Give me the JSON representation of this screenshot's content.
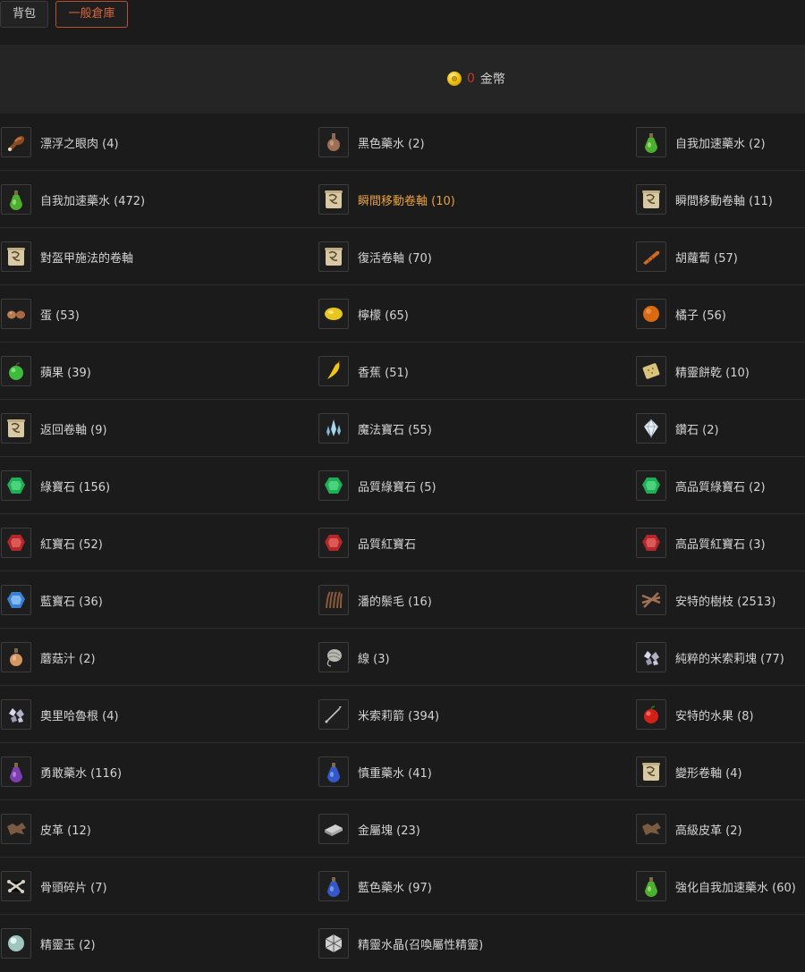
{
  "tabs": [
    {
      "label": "背包",
      "active": false
    },
    {
      "label": "一般倉庫",
      "active": true
    }
  ],
  "currency": {
    "icon": "gold-coin-icon",
    "amount": "0",
    "label": "金幣"
  },
  "colors": {
    "accent": "#d9643c",
    "highlight": "#e8a23c",
    "coin_amount": "#c0392b"
  },
  "items": [
    {
      "label": "漂浮之眼肉 (4)",
      "icon": "meat-icon",
      "highlight": false
    },
    {
      "label": "黑色藥水 (2)",
      "icon": "dark-potion-icon",
      "highlight": false
    },
    {
      "label": "自我加速藥水 (2)",
      "icon": "green-potion-icon",
      "highlight": false
    },
    {
      "label": "自我加速藥水 (472)",
      "icon": "green-potion-icon",
      "highlight": false
    },
    {
      "label": "瞬間移動卷軸 (10)",
      "icon": "scroll-icon",
      "highlight": true
    },
    {
      "label": "瞬間移動卷軸 (11)",
      "icon": "scroll-icon",
      "highlight": false
    },
    {
      "label": "對盔甲施法的卷軸",
      "icon": "scroll-icon",
      "highlight": false
    },
    {
      "label": "復活卷軸 (70)",
      "icon": "scroll-icon",
      "highlight": false
    },
    {
      "label": "胡蘿蔔 (57)",
      "icon": "carrot-icon",
      "highlight": false
    },
    {
      "label": "蛋 (53)",
      "icon": "egg-icon",
      "highlight": false
    },
    {
      "label": "檸檬 (65)",
      "icon": "lemon-icon",
      "highlight": false
    },
    {
      "label": "橘子 (56)",
      "icon": "orange-icon",
      "highlight": false
    },
    {
      "label": "蘋果 (39)",
      "icon": "green-apple-icon",
      "highlight": false
    },
    {
      "label": "香蕉 (51)",
      "icon": "banana-icon",
      "highlight": false
    },
    {
      "label": "精靈餅乾 (10)",
      "icon": "biscuit-icon",
      "highlight": false
    },
    {
      "label": "返回卷軸 (9)",
      "icon": "scroll-icon",
      "highlight": false
    },
    {
      "label": "魔法寶石 (55)",
      "icon": "crystal-icon",
      "highlight": false
    },
    {
      "label": "鑽石 (2)",
      "icon": "diamond-icon",
      "highlight": false
    },
    {
      "label": "綠寶石 (156)",
      "icon": "emerald-icon",
      "highlight": false
    },
    {
      "label": "品質綠寶石 (5)",
      "icon": "emerald-icon",
      "highlight": false
    },
    {
      "label": "高品質綠寶石 (2)",
      "icon": "emerald-icon",
      "highlight": false
    },
    {
      "label": "紅寶石 (52)",
      "icon": "ruby-icon",
      "highlight": false
    },
    {
      "label": "品質紅寶石",
      "icon": "ruby-icon",
      "highlight": false
    },
    {
      "label": "高品質紅寶石 (3)",
      "icon": "ruby-icon",
      "highlight": false
    },
    {
      "label": "藍寶石 (36)",
      "icon": "sapphire-icon",
      "highlight": false
    },
    {
      "label": "潘的鬃毛 (16)",
      "icon": "mane-icon",
      "highlight": false
    },
    {
      "label": "安特的樹枝 (2513)",
      "icon": "branch-icon",
      "highlight": false
    },
    {
      "label": "蘑菇汁 (2)",
      "icon": "mushroom-juice-icon",
      "highlight": false
    },
    {
      "label": "線 (3)",
      "icon": "thread-icon",
      "highlight": false
    },
    {
      "label": "純粹的米索莉塊 (77)",
      "icon": "ore-icon",
      "highlight": false
    },
    {
      "label": "奧里哈魯根 (4)",
      "icon": "ore-icon",
      "highlight": false
    },
    {
      "label": "米索莉箭 (394)",
      "icon": "arrow-icon",
      "highlight": false
    },
    {
      "label": "安特的水果 (8)",
      "icon": "red-apple-icon",
      "highlight": false
    },
    {
      "label": "勇敢藥水 (116)",
      "icon": "purple-potion-icon",
      "highlight": false
    },
    {
      "label": "慎重藥水 (41)",
      "icon": "blue-potion-icon",
      "highlight": false
    },
    {
      "label": "變形卷軸 (4)",
      "icon": "scroll-icon",
      "highlight": false
    },
    {
      "label": "皮革 (12)",
      "icon": "leather-icon",
      "highlight": false
    },
    {
      "label": "金屬塊 (23)",
      "icon": "metal-block-icon",
      "highlight": false
    },
    {
      "label": "高級皮革 (2)",
      "icon": "leather-icon",
      "highlight": false
    },
    {
      "label": "骨頭碎片 (7)",
      "icon": "bone-icon",
      "highlight": false
    },
    {
      "label": "藍色藥水 (97)",
      "icon": "blue-potion-icon",
      "highlight": false
    },
    {
      "label": "強化自我加速藥水 (60)",
      "icon": "green-potion-icon",
      "highlight": false
    },
    {
      "label": "精靈玉 (2)",
      "icon": "pearl-icon",
      "highlight": false
    },
    {
      "label": "精靈水晶(召喚屬性精靈)",
      "icon": "spirit-crystal-icon",
      "highlight": false
    }
  ]
}
